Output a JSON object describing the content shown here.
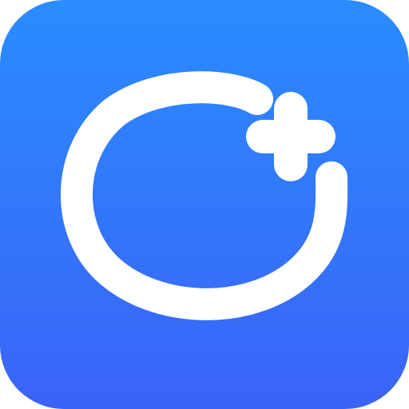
{
  "icon": {
    "name": "app-icon",
    "symbol": "ring-with-plus",
    "colors": {
      "gradient_top": "#2a8cff",
      "gradient_bottom": "#3a63f7",
      "glyph": "#ffffff"
    }
  }
}
